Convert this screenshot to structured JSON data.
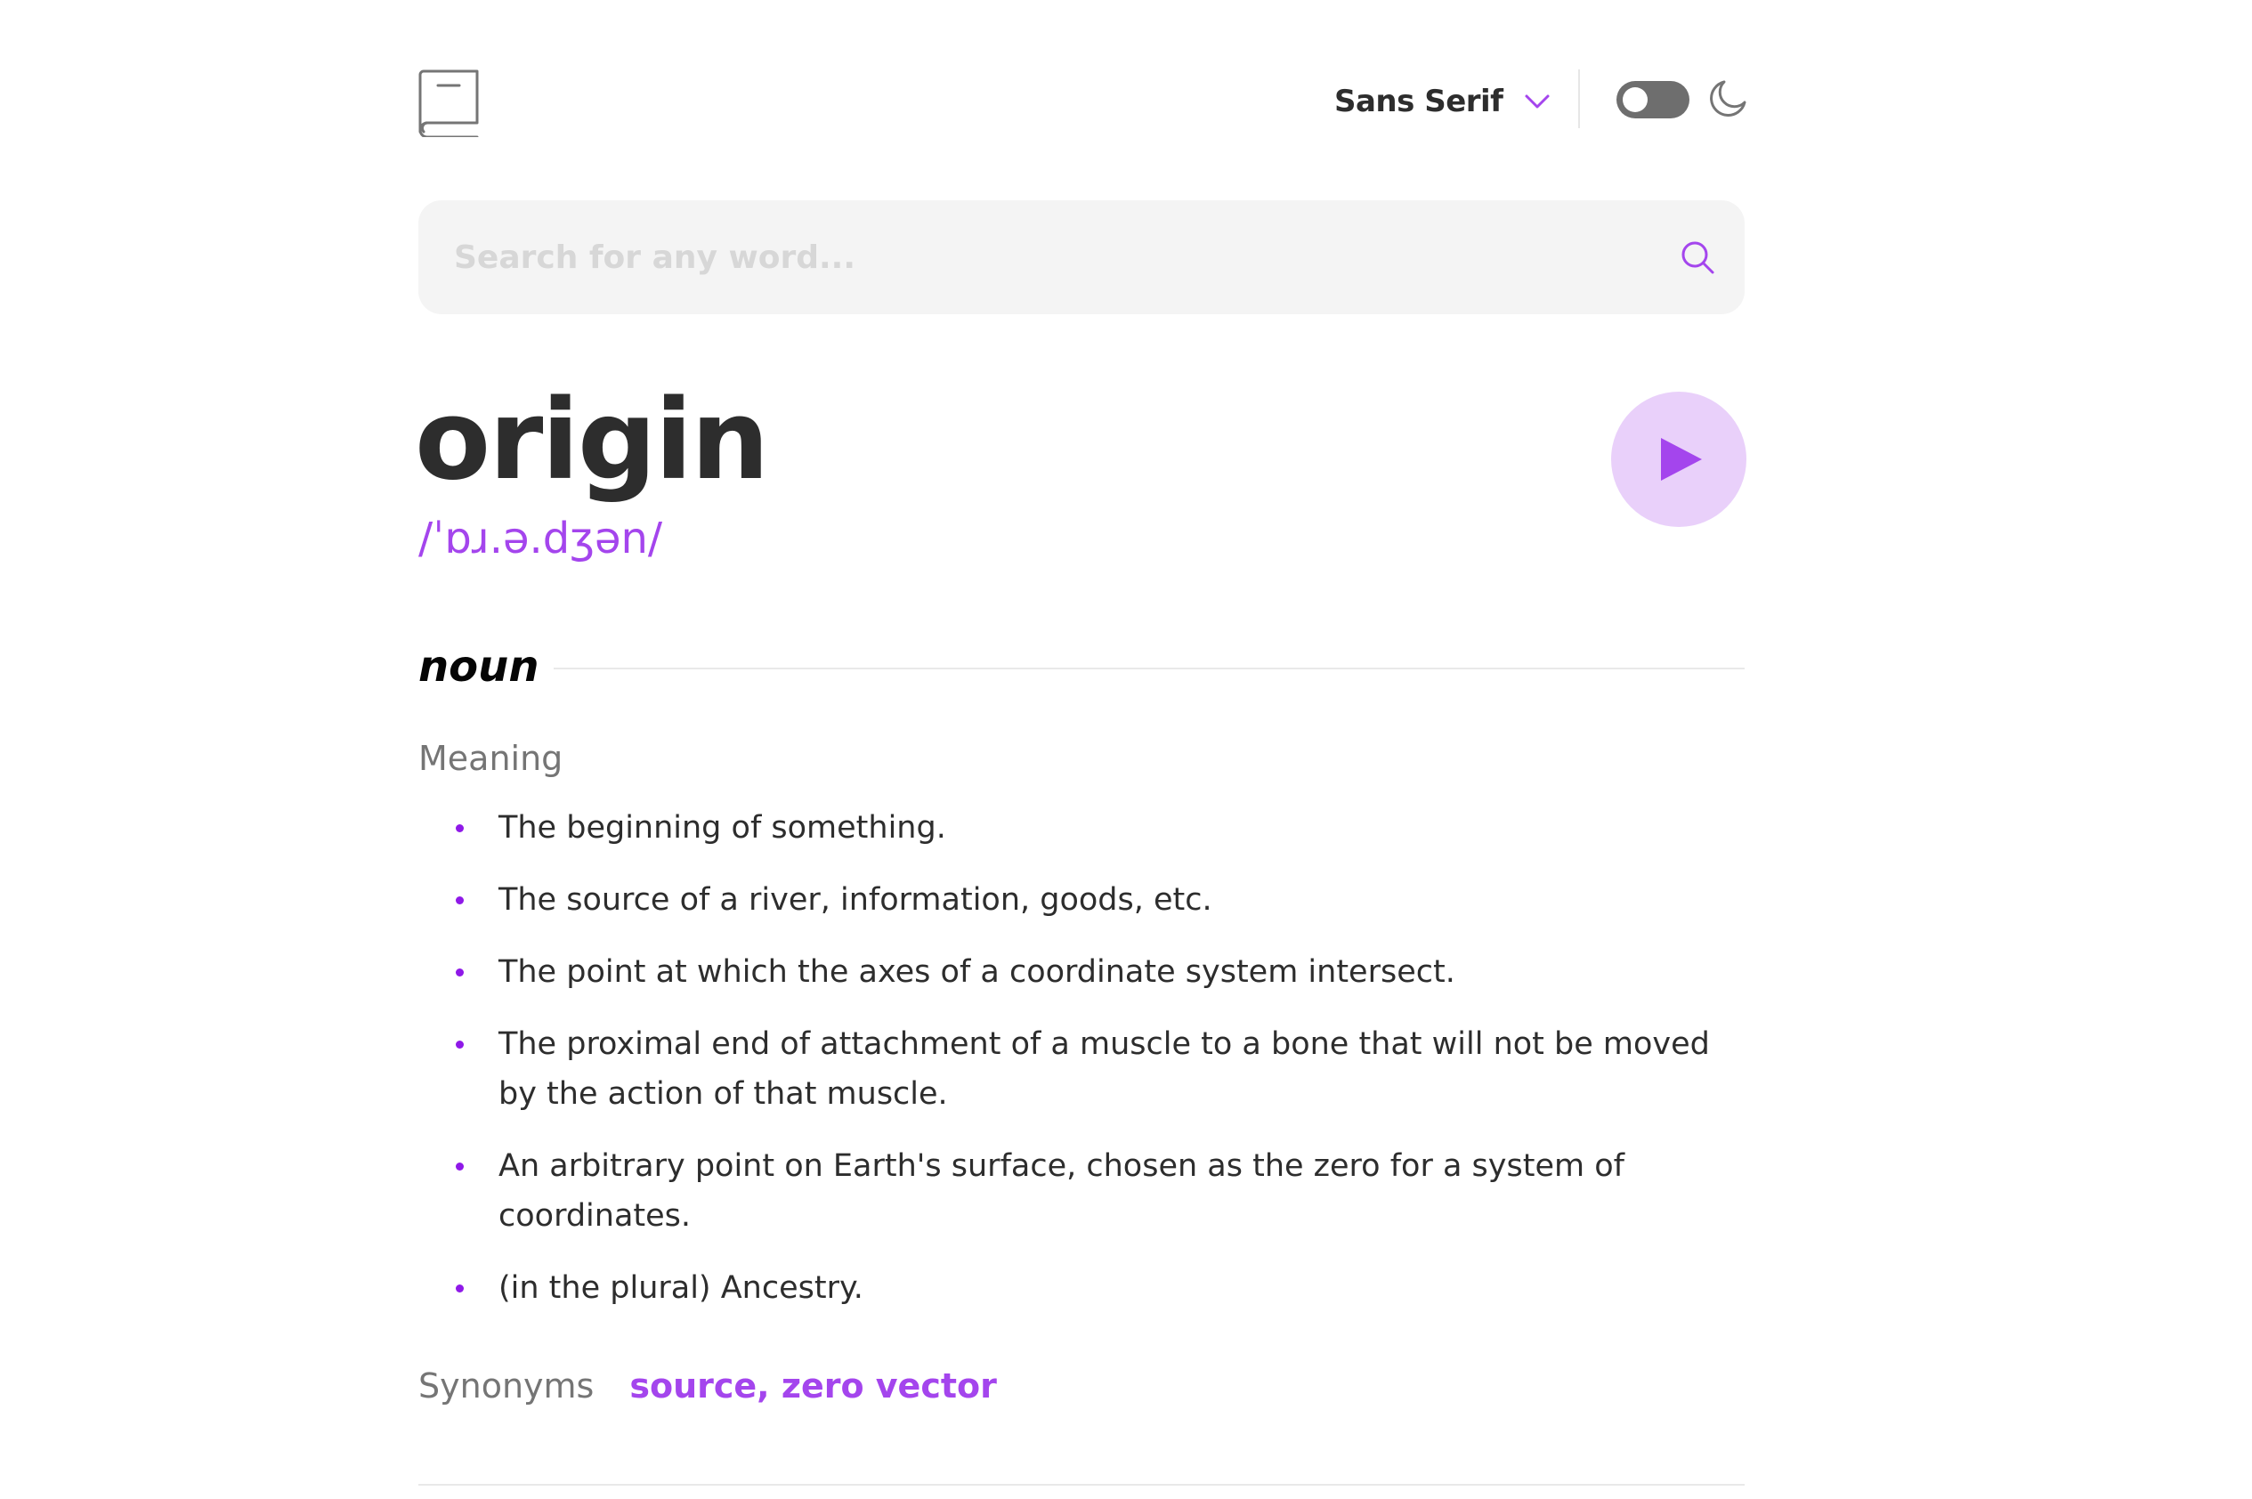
{
  "header": {
    "font_selected": "Sans Serif",
    "theme_toggle_on": false,
    "icons": {
      "logo": "book-icon",
      "dropdown": "chevron-down-icon",
      "theme": "moon-icon"
    }
  },
  "search": {
    "placeholder": "Search for any word...",
    "value": "",
    "icon": "search-icon"
  },
  "entry": {
    "word": "origin",
    "phonetic": "/ˈɒɹ.ə.dʒən/",
    "play_icon": "play-icon",
    "meanings": [
      {
        "part_of_speech": "noun",
        "heading": "Meaning",
        "definitions": [
          "The beginning of something.",
          "The source of a river, information, goods, etc.",
          "The point at which the axes of a coordinate system intersect.",
          "The proximal end of attachment of a muscle to a bone that will not be moved by the action of that muscle.",
          "An arbitrary point on Earth's surface, chosen as the zero for a system of coordinates.",
          "(in the plural) Ancestry."
        ],
        "synonyms_label": "Synonyms",
        "synonyms": "source, zero vector"
      }
    ]
  },
  "colors": {
    "accent": "#A445ED",
    "text": "#2D2D2D",
    "muted": "#757575",
    "search_bg": "#F4F4F4",
    "play_bg": "#E9D0FA"
  }
}
